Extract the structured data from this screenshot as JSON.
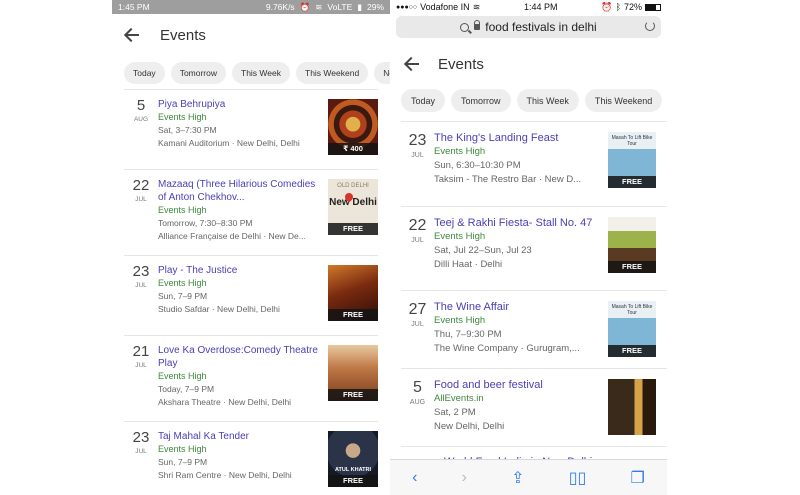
{
  "left": {
    "status": {
      "time": "1:45 PM",
      "speed": "9.76K/s",
      "carrier": "VoLTE",
      "battery": "29%"
    },
    "title": "Events",
    "chips": [
      "Today",
      "Tomorrow",
      "This Week",
      "This Weekend",
      "Next W"
    ],
    "events": [
      {
        "day": "5",
        "month": "AUG",
        "name": "Piya Behrupiya",
        "source": "Events High",
        "when": "Sat, 3–7:30 PM",
        "where": "Kamani Auditorium · New Delhi, Delhi",
        "price": "₹ 400",
        "thumb_color": "#7a2a1a"
      },
      {
        "day": "22",
        "month": "JUL",
        "name": "Mazaaq (Three Hilarious Comedies of Anton Chekhov...",
        "source": "Events High",
        "when": "Tomorrow, 7:30–8:30 PM",
        "where": "Alliance Française de Delhi · New De...",
        "price": "FREE",
        "thumb_color": "#d9d0c0"
      },
      {
        "day": "23",
        "month": "JUL",
        "name": "Play - The Justice",
        "source": "Events High",
        "when": "Sun, 7–9 PM",
        "where": "Studio Safdar · New Delhi, Delhi",
        "price": "FREE",
        "thumb_color": "#8a3a10"
      },
      {
        "day": "21",
        "month": "JUL",
        "name": "Love Ka Overdose:Comedy Theatre Play",
        "source": "Events High",
        "when": "Today, 7–9 PM",
        "where": "Akshara Theatre · New Delhi, Delhi",
        "price": "FREE",
        "thumb_color": "#b05a30"
      },
      {
        "day": "23",
        "month": "JUL",
        "name": "Taj Mahal Ka Tender",
        "source": "Events High",
        "when": "Sun, 7–9 PM",
        "where": "Shri Ram Centre · New Delhi, Delhi",
        "price": "FREE",
        "thumb_color": "#1d2535"
      }
    ],
    "thumb_text": {
      "old_delhi_top": "OLD DELHI",
      "old_delhi_main": "New Delhi",
      "atul": "ATUL KHATRI"
    }
  },
  "right": {
    "status": {
      "carrier": "Vodafone IN",
      "time": "1:44 PM",
      "battery": "72%"
    },
    "url": "food festivals in delhi",
    "title": "Events",
    "chips": [
      "Today",
      "Tomorrow",
      "This Week",
      "This Weekend",
      "Ne"
    ],
    "events": [
      {
        "day": "23",
        "month": "JUL",
        "name": "The King's Landing Feast",
        "source": "Events High",
        "when": "Sun, 6:30–10:30 PM",
        "where": "Taksim - The Restro Bar · New D...",
        "price": "FREE",
        "thumb_color": "#6fa8c9"
      },
      {
        "day": "22",
        "month": "JUL",
        "name": "Teej & Rakhi Fiesta- Stall No. 47",
        "source": "Events High",
        "when": "Sat, Jul 22–Sun, Jul 23",
        "where": "Dilli Haat · Delhi",
        "price": "FREE",
        "thumb_color": "#8ea33a"
      },
      {
        "day": "27",
        "month": "JUL",
        "name": "The Wine Affair",
        "source": "Events High",
        "when": "Thu, 7–9:30 PM",
        "where": "The Wine Company · Gurugram,...",
        "price": "FREE",
        "thumb_color": "#6fa8c9"
      },
      {
        "day": "5",
        "month": "AUG",
        "name": "Food and beer festival",
        "source": "AllEvents.in",
        "when": "Sat, 2 PM",
        "where": "New Delhi, Delhi",
        "price": "",
        "thumb_color": "#a06a2a"
      }
    ],
    "partial_event": "World Food India in New Delhi",
    "thumb_text": {
      "masah": "Masah To Lift Bike Tour"
    }
  },
  "colors": {
    "link": "#4a3fb4",
    "source": "#3c8a3c",
    "ios_blue": "#2f7cf6"
  }
}
